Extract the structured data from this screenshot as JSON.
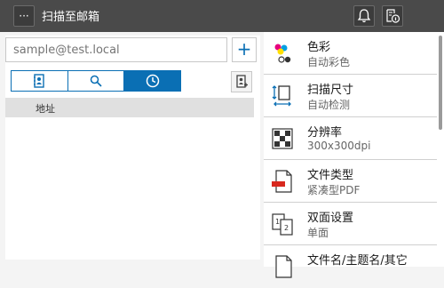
{
  "header": {
    "menu_label": "···",
    "title": "扫描至邮箱"
  },
  "address": {
    "placeholder": "sample@test.local",
    "add_label": "+"
  },
  "tabs": [
    {
      "icon": "address-book-icon",
      "active": false
    },
    {
      "icon": "search-icon",
      "active": false
    },
    {
      "icon": "clock-icon",
      "active": true
    }
  ],
  "list": {
    "column_header": "地址"
  },
  "settings": [
    {
      "label": "色彩",
      "value": "自动彩色",
      "icon": "color-icon"
    },
    {
      "label": "扫描尺寸",
      "value": "自动检测",
      "icon": "scan-size-icon"
    },
    {
      "label": "分辨率",
      "value": "300x300dpi",
      "icon": "resolution-icon"
    },
    {
      "label": "文件类型",
      "value": "紧凑型PDF",
      "icon": "compact-pdf-icon"
    },
    {
      "label": "双面设置",
      "value": "单面",
      "icon": "duplex-icon"
    },
    {
      "label": "文件名/主题名/其它",
      "value": "",
      "icon": "file-icon"
    }
  ],
  "accent_color": "#0a6fb4"
}
